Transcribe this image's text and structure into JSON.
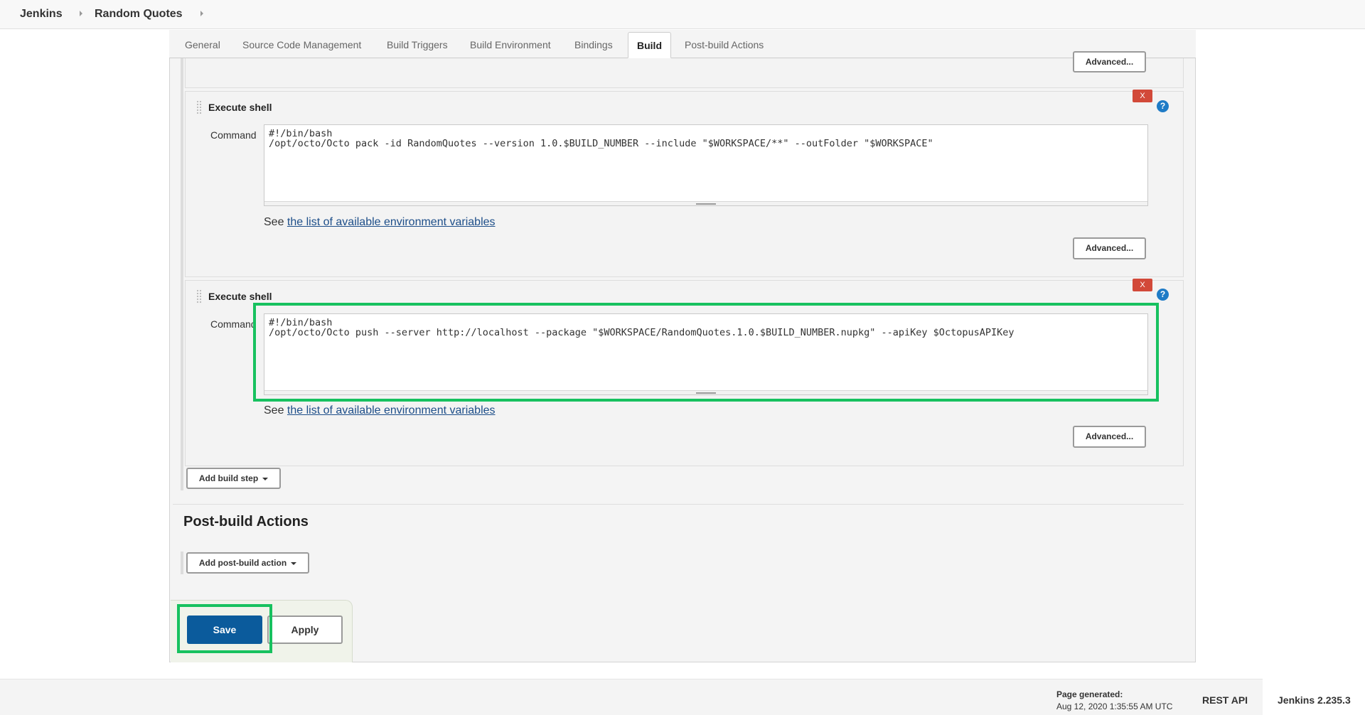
{
  "breadcrumb": {
    "home": "Jenkins",
    "job": "Random Quotes"
  },
  "tabs": [
    {
      "label": "General"
    },
    {
      "label": "Source Code Management"
    },
    {
      "label": "Build Triggers"
    },
    {
      "label": "Build Environment"
    },
    {
      "label": "Bindings"
    },
    {
      "label": "Build"
    },
    {
      "label": "Post-build Actions"
    }
  ],
  "active_tab": "Build",
  "advanced_label": "Advanced...",
  "build_steps": [
    {
      "title": "Execute shell",
      "delete_label": "X",
      "help_label": "?",
      "command_label": "Command",
      "command_line1": "#!/bin/bash",
      "command_line2": "/opt/octo/Octo pack -id RandomQuotes --version 1.0.$BUILD_NUMBER --include \"$WORKSPACE/**\" --outFolder \"$WORKSPACE\"",
      "see_prefix": "See",
      "see_link": "the list of available environment variables"
    },
    {
      "title": "Execute shell",
      "delete_label": "X",
      "help_label": "?",
      "command_label": "Command",
      "command_line1": "#!/bin/bash",
      "command_line2": "/opt/octo/Octo push --server http://localhost --package \"$WORKSPACE/RandomQuotes.1.0.$BUILD_NUMBER.nupkg\" --apiKey $OctopusAPIKey",
      "see_prefix": "See",
      "see_link": "the list of available environment variables"
    }
  ],
  "add_build_step_label": "Add build step",
  "post_build": {
    "heading": "Post-build Actions",
    "add_label": "Add post-build action"
  },
  "actions": {
    "save": "Save",
    "apply": "Apply"
  },
  "highlight_color": "#17c15f",
  "footer": {
    "generated_label": "Page generated:",
    "generated_date": "Aug 12, 2020 1:35:55 AM UTC",
    "rest_api": "REST API",
    "version": "Jenkins 2.235.3"
  }
}
